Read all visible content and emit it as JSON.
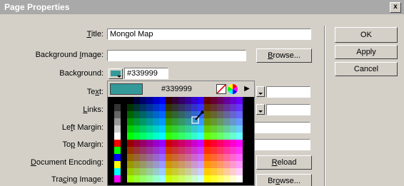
{
  "window": {
    "title": "Page Properties",
    "close_glyph": "x"
  },
  "form": {
    "title_label": {
      "pre": "",
      "u": "T",
      "post": "itle:"
    },
    "title_value": "Mongol Map",
    "bg_image_label": {
      "pre": "Background ",
      "u": "I",
      "post": "mage:"
    },
    "bg_image_value": "",
    "background_label": {
      "pre": "Background:",
      "u": "",
      "post": ""
    },
    "background_value": "#339999",
    "text_label": {
      "pre": "Te",
      "u": "x",
      "post": "t:"
    },
    "links_label": {
      "pre": "",
      "u": "L",
      "post": "inks:"
    },
    "left_margin_label": {
      "pre": "Le",
      "u": "f",
      "post": "t Margin:"
    },
    "top_margin_label": {
      "pre": "To",
      "u": "p",
      "post": " Margin:"
    },
    "doc_encoding_label": {
      "pre": "",
      "u": "D",
      "post": "ocument Encoding:"
    },
    "tracing_image_label": {
      "pre": "Tra",
      "u": "c",
      "post": "ing Image:"
    }
  },
  "buttons": {
    "browse_1": {
      "pre": "",
      "u": "B",
      "post": "rowse..."
    },
    "reload": {
      "pre": "",
      "u": "R",
      "post": "eload"
    },
    "browse_2": {
      "pre": "Br",
      "u": "o",
      "post": "wse..."
    },
    "ok": "OK",
    "apply": "Apply",
    "cancel": "Cancel"
  },
  "palette": {
    "selected_hex": "#339999",
    "selected_color": "#339999",
    "icons": [
      "no-color-icon",
      "color-wheel-icon",
      "palette-menu-arrow-icon",
      "eyedropper-icon"
    ]
  }
}
